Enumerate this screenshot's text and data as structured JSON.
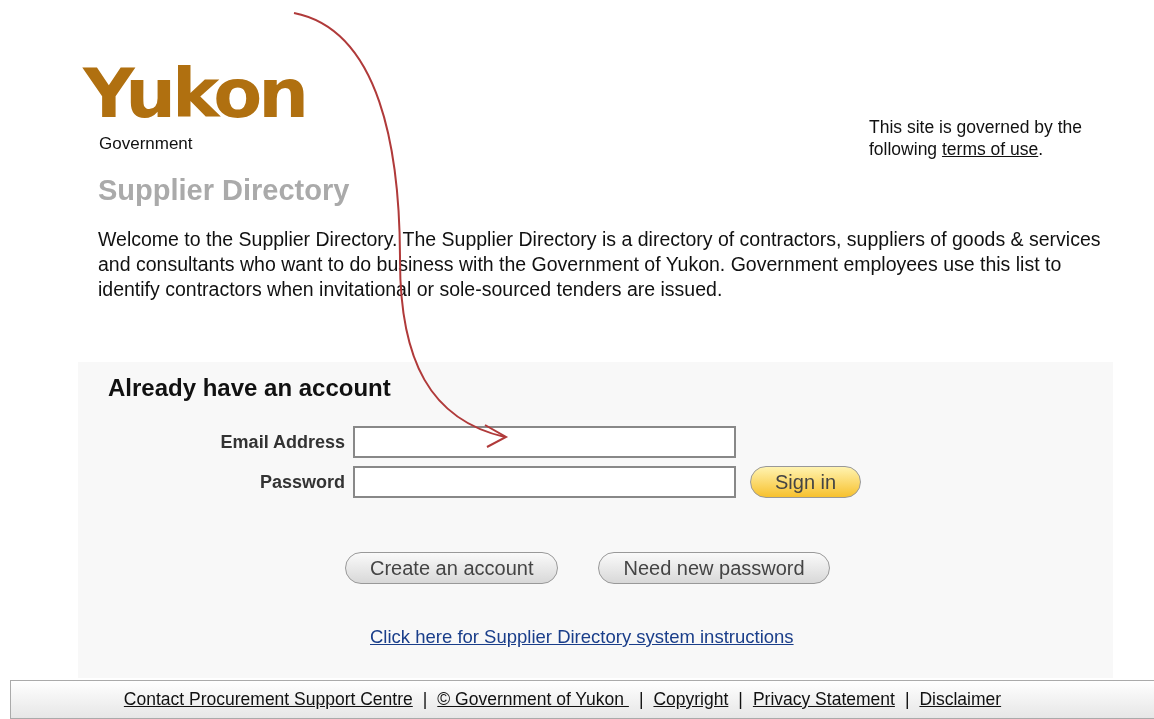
{
  "logo": {
    "wordmark": "Yukon",
    "subtitle": "Government"
  },
  "terms": {
    "text": "This site is governed by the following ",
    "link": "terms of use",
    "end": "."
  },
  "title": "Supplier Directory",
  "intro": "Welcome to the Supplier Directory. The Supplier Directory is a directory of contractors, suppliers of goods & services and consultants who want to do business with the Government of Yukon. Government employees use this list to identify contractors when invitational or sole-sourced tenders are issued.",
  "login": {
    "heading": "Already have an account",
    "fields": [
      {
        "label": "Email Address"
      },
      {
        "label": "Password"
      }
    ],
    "sign_in": "Sign in",
    "buttons": [
      "Create an account",
      "Need new password"
    ],
    "instructions_link": "Click here for Supplier Directory system instructions"
  },
  "footer": {
    "separator": "|",
    "links": [
      "Contact Procurement Support Centre",
      "© Government of Yukon ",
      "Copyright",
      "Privacy Statement",
      "Disclaimer"
    ]
  }
}
